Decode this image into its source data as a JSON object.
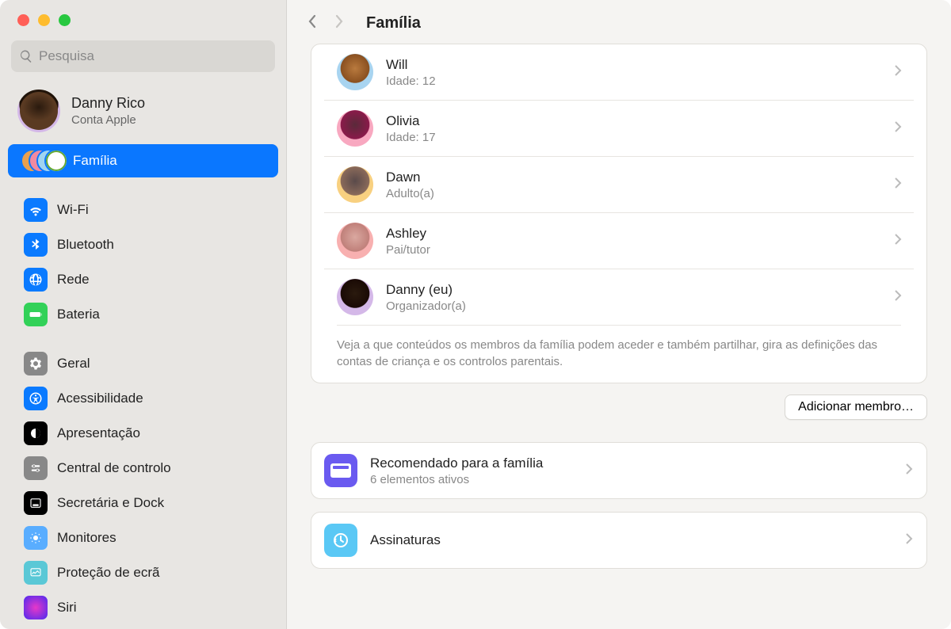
{
  "search_placeholder": "Pesquisa",
  "account": {
    "name": "Danny Rico",
    "sub": "Conta Apple"
  },
  "sidebar": {
    "family": "Família",
    "items1": [
      {
        "label": "Wi-Fi"
      },
      {
        "label": "Bluetooth"
      },
      {
        "label": "Rede"
      },
      {
        "label": "Bateria"
      }
    ],
    "items2": [
      {
        "label": "Geral"
      },
      {
        "label": "Acessibilidade"
      },
      {
        "label": "Apresentação"
      },
      {
        "label": "Central de controlo"
      },
      {
        "label": "Secretária e Dock"
      },
      {
        "label": "Monitores"
      },
      {
        "label": "Proteção de ecrã"
      },
      {
        "label": "Siri"
      }
    ]
  },
  "header": {
    "title": "Família"
  },
  "members": [
    {
      "name": "Will",
      "sub": "Idade: 12"
    },
    {
      "name": "Olivia",
      "sub": "Idade: 17"
    },
    {
      "name": "Dawn",
      "sub": "Adulto(a)"
    },
    {
      "name": "Ashley",
      "sub": "Pai/tutor"
    },
    {
      "name": "Danny (eu)",
      "sub": "Organizador(a)"
    }
  ],
  "members_footer": "Veja a que conteúdos os membros da família podem aceder e também partilhar, gira as definições das contas de criança e os controlos parentais.",
  "add_button": "Adicionar membro…",
  "recommended": {
    "title": "Recomendado para a família",
    "sub": "6 elementos ativos"
  },
  "subscriptions": {
    "title": "Assinaturas"
  }
}
